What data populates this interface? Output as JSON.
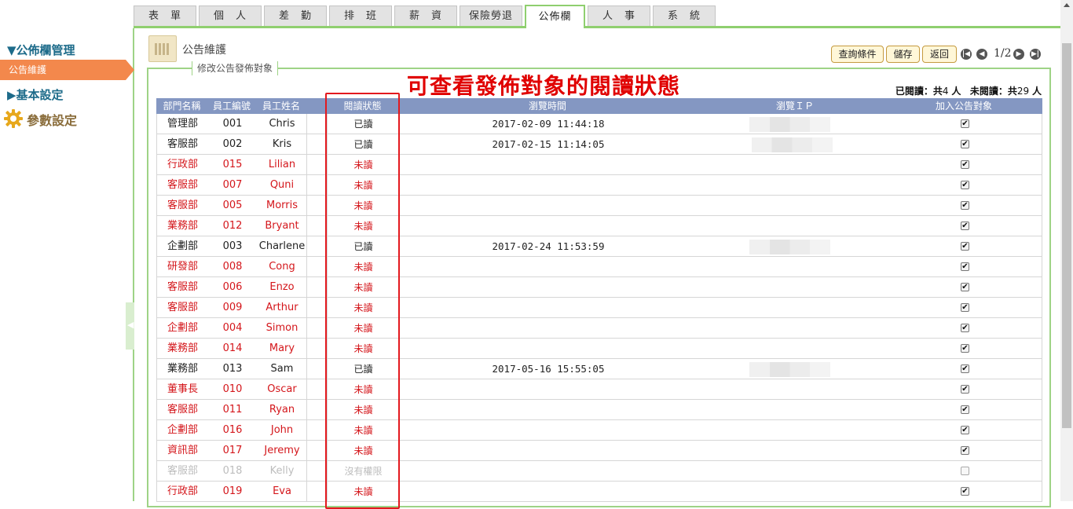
{
  "tabs": [
    "表　單",
    "個　人",
    "差　勤",
    "排　班",
    "薪　資",
    "保險勞退",
    "公佈欄",
    "人　事",
    "系　統"
  ],
  "active_tab": "公佈欄",
  "sidebar": {
    "section1": "▼公佈欄管理",
    "active_item": "公告維護",
    "section2": "▶基本設定",
    "section3": "參數設定"
  },
  "page": {
    "title": "公告維護",
    "legend": "修改公告發佈對象",
    "annotation": "可查看發佈對象的閱讀狀態",
    "counts": {
      "read_label": "已閱讀：共",
      "read_count": "4",
      "unit1": "人",
      "unread_label": "未閱讀：共",
      "unread_count": "29",
      "unit2": "人"
    }
  },
  "toolbar": {
    "query": "查詢條件",
    "save": "儲存",
    "back": "返回",
    "pager": "1/2"
  },
  "table": {
    "headers": [
      "部門名稱",
      "員工編號",
      "員工姓名",
      "",
      "閱讀狀態",
      "瀏覽時間",
      "瀏覽ＩＰ",
      "加入公告對象"
    ],
    "rows": [
      {
        "dept": "管理部",
        "id": "001",
        "name": "Chris",
        "status": "已讀",
        "time": "2017-02-09 11:44:18",
        "ip": true,
        "checked": true,
        "tone": "normal"
      },
      {
        "dept": "客服部",
        "id": "002",
        "name": "Kris",
        "status": "已讀",
        "time": "2017-02-15 11:14:05",
        "ip": true,
        "checked": true,
        "tone": "normal"
      },
      {
        "dept": "行政部",
        "id": "015",
        "name": "Lilian",
        "status": "未讀",
        "time": "",
        "ip": false,
        "checked": true,
        "tone": "red"
      },
      {
        "dept": "客服部",
        "id": "007",
        "name": "Quni",
        "status": "未讀",
        "time": "",
        "ip": false,
        "checked": true,
        "tone": "red"
      },
      {
        "dept": "客服部",
        "id": "005",
        "name": "Morris",
        "status": "未讀",
        "time": "",
        "ip": false,
        "checked": true,
        "tone": "red"
      },
      {
        "dept": "業務部",
        "id": "012",
        "name": "Bryant",
        "status": "未讀",
        "time": "",
        "ip": false,
        "checked": true,
        "tone": "red"
      },
      {
        "dept": "企劃部",
        "id": "003",
        "name": "Charlene",
        "status": "已讀",
        "time": "2017-02-24 11:53:59",
        "ip": true,
        "checked": true,
        "tone": "normal"
      },
      {
        "dept": "研發部",
        "id": "008",
        "name": "Cong",
        "status": "未讀",
        "time": "",
        "ip": false,
        "checked": true,
        "tone": "red"
      },
      {
        "dept": "客服部",
        "id": "006",
        "name": "Enzo",
        "status": "未讀",
        "time": "",
        "ip": false,
        "checked": true,
        "tone": "red"
      },
      {
        "dept": "客服部",
        "id": "009",
        "name": "Arthur",
        "status": "未讀",
        "time": "",
        "ip": false,
        "checked": true,
        "tone": "red"
      },
      {
        "dept": "企劃部",
        "id": "004",
        "name": "Simon",
        "status": "未讀",
        "time": "",
        "ip": false,
        "checked": true,
        "tone": "red"
      },
      {
        "dept": "業務部",
        "id": "014",
        "name": "Mary",
        "status": "未讀",
        "time": "",
        "ip": false,
        "checked": true,
        "tone": "red"
      },
      {
        "dept": "業務部",
        "id": "013",
        "name": "Sam",
        "status": "已讀",
        "time": "2017-05-16 15:55:05",
        "ip": true,
        "checked": true,
        "tone": "normal"
      },
      {
        "dept": "董事長",
        "id": "010",
        "name": "Oscar",
        "status": "未讀",
        "time": "",
        "ip": false,
        "checked": true,
        "tone": "red"
      },
      {
        "dept": "客服部",
        "id": "011",
        "name": "Ryan",
        "status": "未讀",
        "time": "",
        "ip": false,
        "checked": true,
        "tone": "red"
      },
      {
        "dept": "企劃部",
        "id": "016",
        "name": "John",
        "status": "未讀",
        "time": "",
        "ip": false,
        "checked": true,
        "tone": "red"
      },
      {
        "dept": "資訊部",
        "id": "017",
        "name": "Jeremy",
        "status": "未讀",
        "time": "",
        "ip": false,
        "checked": true,
        "tone": "red"
      },
      {
        "dept": "客服部",
        "id": "018",
        "name": "Kelly",
        "status": "沒有權限",
        "time": "",
        "ip": false,
        "checked": false,
        "tone": "gray"
      },
      {
        "dept": "行政部",
        "id": "019",
        "name": "Eva",
        "status": "未讀",
        "time": "",
        "ip": false,
        "checked": true,
        "tone": "red"
      }
    ]
  },
  "colors": {
    "accent_green": "#8fcf6f",
    "header_blue": "#8497c2",
    "active_orange": "#f3884c",
    "unread_red": "#d4161b",
    "annotation_red": "#e00000"
  }
}
